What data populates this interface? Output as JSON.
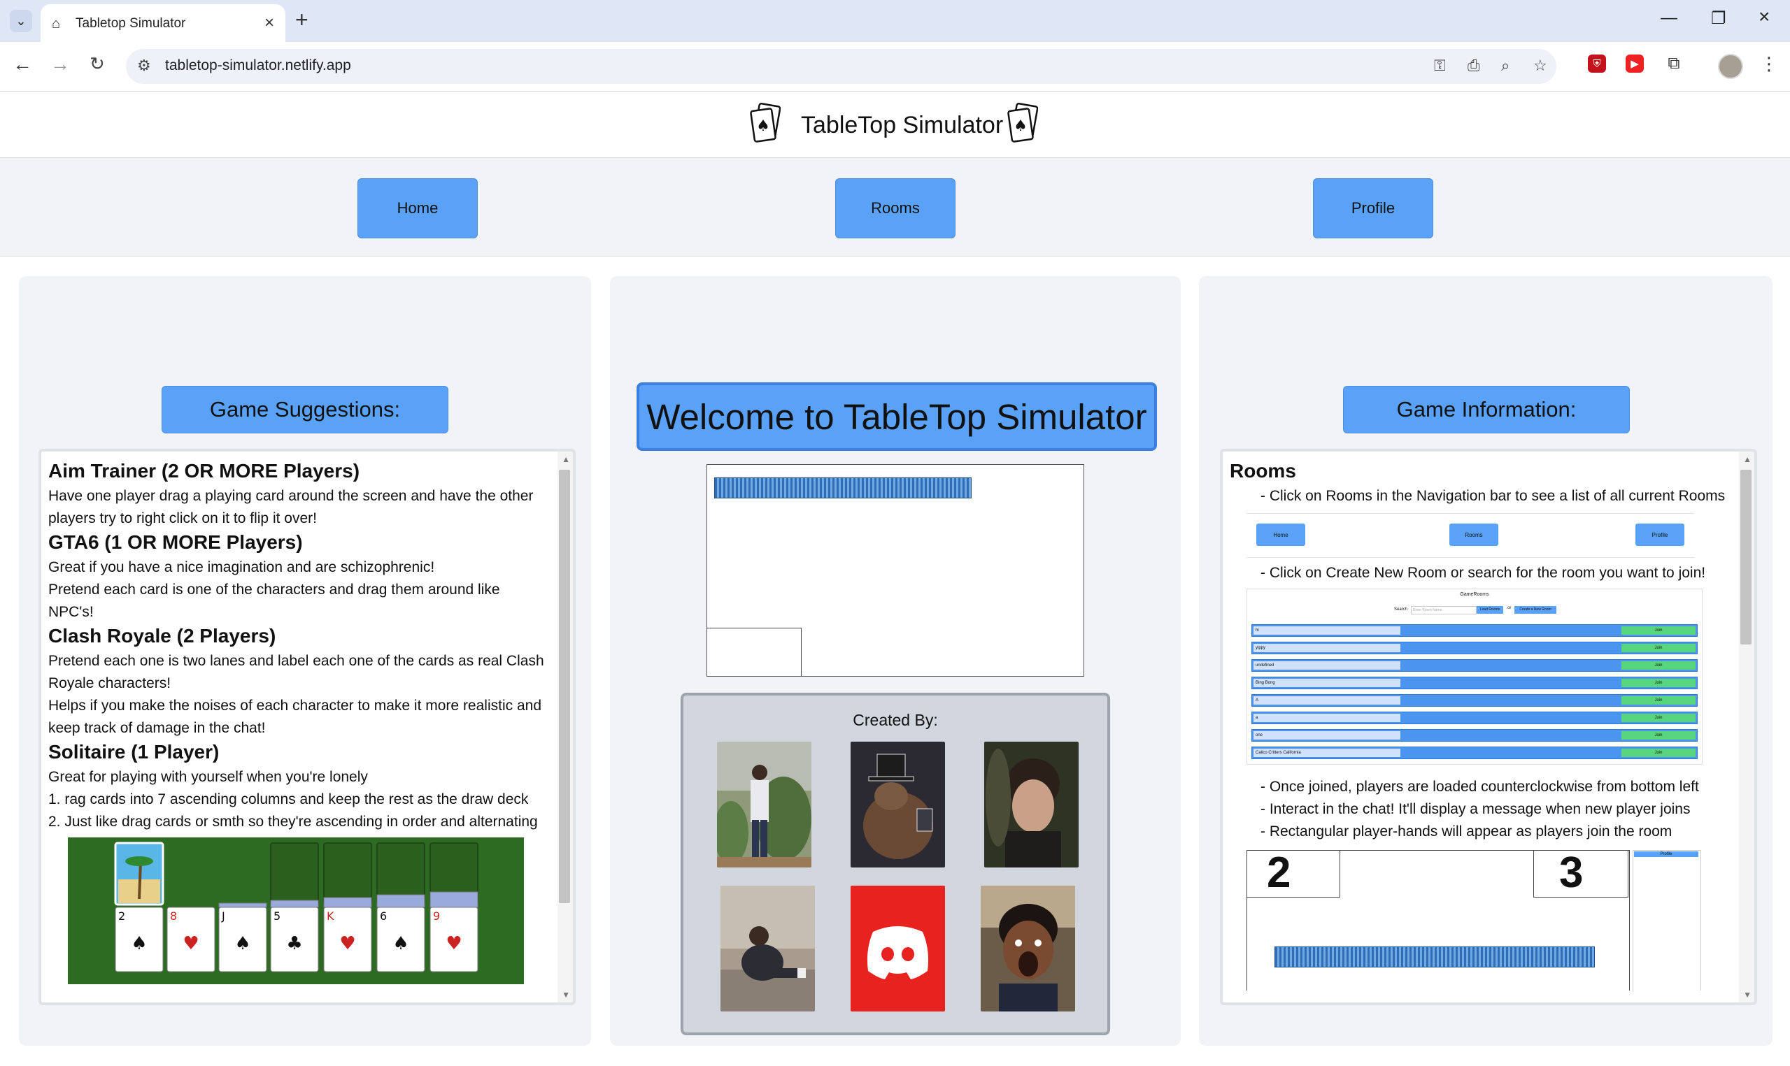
{
  "browser": {
    "tab_title": "Tabletop Simulator",
    "url": "tabletop-simulator.netlify.app"
  },
  "site": {
    "title": "TableTop Simulator"
  },
  "nav": {
    "home": "Home",
    "rooms": "Rooms",
    "profile": "Profile"
  },
  "suggestions": {
    "heading": "Game Suggestions:",
    "games": [
      {
        "title": "Aim Trainer (2 OR MORE Players)",
        "lines": [
          "Have one player drag a playing card around the screen and have the other players try to right click on it to flip it over!"
        ]
      },
      {
        "title": "GTA6 (1 OR MORE Players)",
        "lines": [
          "Great if you have a nice imagination and are schizophrenic!",
          "Pretend each card is one of the characters and drag them around like NPC's!"
        ]
      },
      {
        "title": "Clash Royale (2 Players)",
        "lines": [
          "Pretend each one is two lanes and label each one of the cards as real Clash Royale characters!",
          "Helps if you make the noises of each character to make it more realistic and keep track of damage in the chat!"
        ]
      },
      {
        "title": "Solitaire (1 Player)",
        "lines": [
          "Great for playing with yourself when you're lonely",
          "1. rag cards into 7 ascending columns and keep the rest as the draw deck",
          "2. Just like drag cards or smth so they're ascending in order and alternating"
        ]
      }
    ],
    "solitaire_cards": [
      "2",
      "8",
      "J",
      "5",
      "K",
      "6",
      "9"
    ]
  },
  "welcome": {
    "title": "Welcome to TableTop Simulator",
    "credits_title": "Created By:"
  },
  "info": {
    "heading": "Game Information:",
    "rooms_title": "Rooms",
    "line1": "- Click on Rooms in the Navigation bar to see a list of all current Rooms",
    "line2": "- Click on Create New Room or search for the room you want to join!",
    "line3": "- Once joined, players are loaded counterclockwise from bottom left",
    "line4": "- Interact in the chat! It'll display a message when new player joins",
    "line5": "- Rectangular player-hands will appear as players join the room",
    "mini_nav": [
      "Home",
      "Rooms",
      "Profile"
    ],
    "mini_rooms_title": "GameRooms",
    "mini_search_label": "Search",
    "mini_search_placeholder": "Enter Room Name",
    "mini_load_button": "Load Rooms",
    "mini_or": "or",
    "mini_create_button": "Create a New Room",
    "mini_rooms": [
      "hi",
      "yippy",
      "undefined",
      "Bing Bong",
      "A",
      "a",
      "one",
      "Calico Critters California"
    ],
    "mini_join": "Join",
    "hand_numbers": [
      "2",
      "3"
    ],
    "mini_side_button": "Profile"
  }
}
